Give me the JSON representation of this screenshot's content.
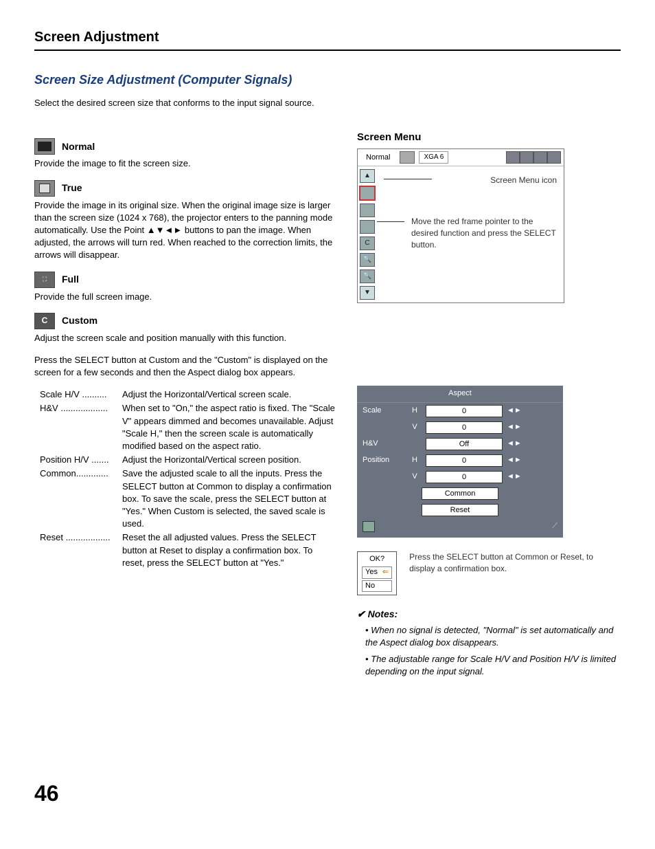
{
  "header": {
    "title": "Screen Adjustment"
  },
  "section": {
    "title": "Screen Size Adjustment (Computer Signals)",
    "intro": "Select the desired screen size that conforms to the input signal source."
  },
  "modes": {
    "normal": {
      "label": "Normal",
      "desc": "Provide the image to fit the screen size."
    },
    "true": {
      "label": "True",
      "desc": "Provide the image in its original size. When the original image size is larger than the screen size (1024 x 768), the projector enters to the panning mode automatically. Use the Point ▲▼◄► buttons to pan the image. When adjusted, the arrows will turn red. When reached to the correction limits, the arrows will disappear."
    },
    "full": {
      "label": "Full",
      "desc": "Provide the full screen image."
    },
    "custom": {
      "label": "Custom",
      "desc1": "Adjust the screen scale and position manually with this function.",
      "desc2": "Press the SELECT button at Custom and the \"Custom\" is displayed on the screen for a few seconds and then the Aspect dialog box appears."
    }
  },
  "defs": [
    {
      "term": "Scale H/V ..........",
      "desc": "Adjust the Horizontal/Vertical screen scale."
    },
    {
      "term": "H&V ...................",
      "desc": "When set to \"On,\" the aspect ratio is fixed. The \"Scale V\" appears dimmed and becomes unavailable. Adjust \"Scale H,\" then the screen scale is automatically modified based on the aspect ratio."
    },
    {
      "term": "Position H/V .......",
      "desc": "Adjust the Horizontal/Vertical screen position."
    },
    {
      "term": "Common.............",
      "desc": "Save the adjusted scale to all the inputs. Press the SELECT button at Common to display a confirmation box. To save the scale, press the SELECT button at \"Yes.\" When Custom is selected, the saved scale is used."
    },
    {
      "term": "Reset ..................",
      "desc": "Reset the all adjusted values. Press the SELECT button at Reset to display a confirmation box. To reset, press the SELECT button at \"Yes.\""
    }
  ],
  "screenMenu": {
    "heading": "Screen Menu",
    "topLabel": "Normal",
    "signal": "XGA 6",
    "iconLabel": "Screen Menu icon",
    "instruction": "Move the red frame pointer to the desired function and press the SELECT button."
  },
  "aspect": {
    "title": "Aspect",
    "rows": {
      "scale": "Scale",
      "hv": "H&V",
      "position": "Position",
      "h": "H",
      "v": "V",
      "zero": "0",
      "off": "Off",
      "common": "Common",
      "reset": "Reset"
    }
  },
  "okbox": {
    "title": "OK?",
    "yes": "Yes",
    "no": "No",
    "caption": "Press the SELECT button at Common or Reset, to display a confirmation box."
  },
  "notes": {
    "heading": "Notes:",
    "items": [
      "When no signal is detected, \"Normal\" is set automatically and the Aspect dialog box disappears.",
      "The adjustable range for Scale H/V and Position H/V is limited depending on the input signal."
    ]
  },
  "pageNumber": "46"
}
